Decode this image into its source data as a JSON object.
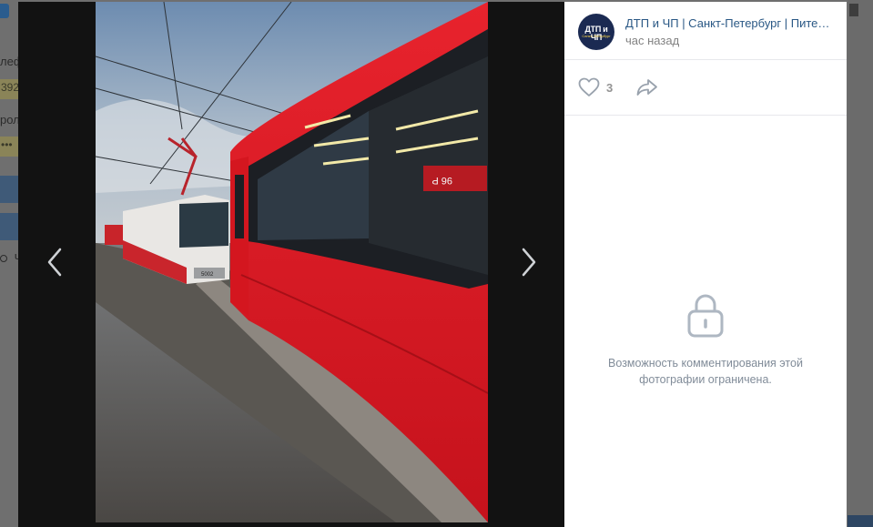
{
  "background": {
    "field_label_1": "лефо",
    "field_value_1": "392",
    "field_label_2": "роль",
    "field_value_2": "•••",
    "link_text": "Ч"
  },
  "post": {
    "group_name": "ДТП и ЧП | Санкт-Петербург | Питер Онлайн | СПб",
    "time": "час назад",
    "avatar_text": "ДТП и ЧП",
    "avatar_subtext": "Санкт-Петербург"
  },
  "actions": {
    "like_count": "3"
  },
  "comments": {
    "restricted_text": "Возможность комментирования этой фотографии ограничена."
  },
  "photo": {
    "tram_number_sign": "96 P",
    "tram_plate": "5002"
  },
  "colors": {
    "link": "#2a5885",
    "muted": "#828282",
    "icon": "#99a2ad",
    "overlay": "#121212"
  },
  "icons": {
    "prev": "chevron-left-icon",
    "next": "chevron-right-icon",
    "like": "heart-icon",
    "share": "share-arrow-icon",
    "lock": "lock-icon"
  }
}
